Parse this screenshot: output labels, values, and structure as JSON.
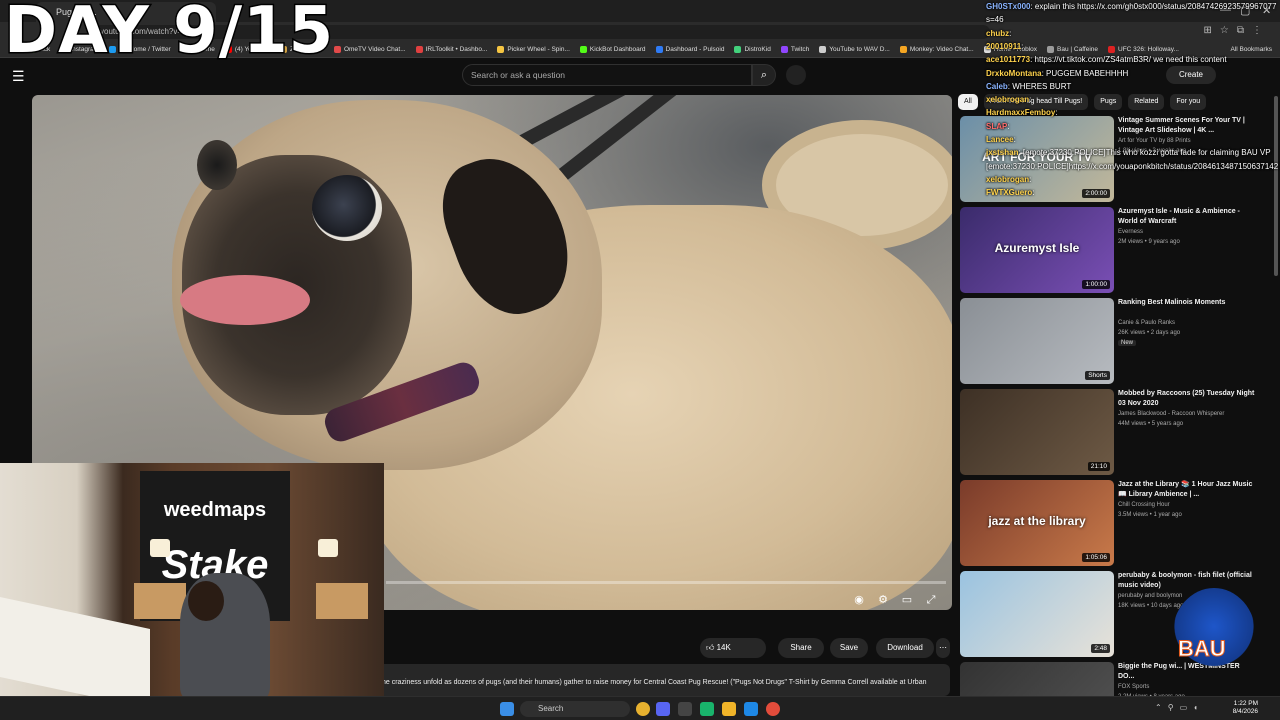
{
  "stream": {
    "day_counter": "DAY 9/15"
  },
  "browser": {
    "tab_title": "Pugs - Y...",
    "url": "youtube.com/watch?v=FGXdB",
    "bookmarks": [
      {
        "label": "Kick",
        "color": "#53fc18"
      },
      {
        "label": "Instagram",
        "color": "#e1306c"
      },
      {
        "label": "(4) Home / Twitter",
        "color": "#1d9bf0"
      },
      {
        "label": "Caffeine",
        "color": "#9b9b9b"
      },
      {
        "label": "(4) YouTube",
        "color": "#ff0000"
      },
      {
        "label": "ZIMONKEY",
        "color": "#d0a040"
      },
      {
        "label": "OmeTV Video Chat...",
        "color": "#e24a4a"
      },
      {
        "label": "IRLToolkit • Dashbo...",
        "color": "#e04040"
      },
      {
        "label": "Picker Wheel - Spin...",
        "color": "#f5c542"
      },
      {
        "label": "KickBot Dashboard",
        "color": "#53fc18"
      },
      {
        "label": "Dashboard - Pulsoid",
        "color": "#2f7bf5"
      },
      {
        "label": "DistroKid",
        "color": "#43d17c"
      },
      {
        "label": "Twitch",
        "color": "#9146ff"
      },
      {
        "label": "YouTube to WAV D...",
        "color": "#cccccc"
      },
      {
        "label": "Monkey: Video Chat...",
        "color": "#f5a623"
      },
      {
        "label": "Home - Roblox",
        "color": "#dddddd"
      },
      {
        "label": "Bau | Caffeine",
        "color": "#9b9b9b"
      },
      {
        "label": "UFC 326: Holloway...",
        "color": "#d22"
      }
    ],
    "all_bookmarks": "All Bookmarks"
  },
  "youtube": {
    "search_placeholder": "Search or ask a question",
    "create_label": "Create",
    "actions": {
      "like_count": "14K",
      "share": "Share",
      "save": "Save",
      "download": "Download"
    },
    "description": "he craziness unfold as dozens of pugs (and their humans) gather to raise money for Central Coast Pug Rescue! (\"Pugs Not Drugs\" T-Shirt by Gemma Correll available at Urban",
    "chips": [
      "All",
      "From The Pug head Till Pugs!",
      "Pugs",
      "Related",
      "For you"
    ],
    "recommendations": [
      {
        "title": "Vintage Summer Scenes For Your TV | Vintage Art Slideshow | 4K ...",
        "channel": "Art for Your TV by 88 Prints",
        "meta": "1.8K views • 3 weeks ago",
        "duration": "2:00:00",
        "thumb_text": "ART FOR YOUR TV",
        "colors": [
          "#6b8fa8",
          "#c2b89a"
        ]
      },
      {
        "title": "Azuremyst Isle - Music & Ambience - World of Warcraft",
        "channel": "Everness",
        "meta": "2M views • 9 years ago",
        "duration": "1:00:00",
        "thumb_text": "Azuremyst Isle",
        "colors": [
          "#3a2b6b",
          "#7a4fb5"
        ]
      },
      {
        "title": "Ranking Best Malinois Moments",
        "channel": "Canie & Paulo Ranks",
        "meta": "26K views • 2 days ago",
        "badge": "New",
        "duration": "Shorts",
        "thumb_text": "",
        "colors": [
          "#8a8f95",
          "#b7bbc0"
        ]
      },
      {
        "title": "Mobbed by Raccoons  (25) Tuesday Night 03 Nov 2020",
        "channel": "James Blackwood - Raccoon Whisperer",
        "meta": "44M views • 5 years ago",
        "duration": "21:10",
        "thumb_text": "",
        "colors": [
          "#3d3025",
          "#6e5a45"
        ]
      },
      {
        "title": "Jazz at the Library 📚 1 Hour Jazz Music 📖 Library Ambience | ...",
        "channel": "Chill Crossing Hour",
        "meta": "3.5M views • 1 year ago",
        "duration": "1:05:06",
        "thumb_text": "jazz at the library",
        "colors": [
          "#7a3b2a",
          "#c97a4a"
        ]
      },
      {
        "title": "perubaby & boolymon - fish filet (official music video)",
        "channel": "perubaby and boolymon",
        "meta": "18K views • 10 days ago",
        "duration": "2:48",
        "thumb_text": "",
        "colors": [
          "#9ac3e0",
          "#e8e2d8"
        ]
      },
      {
        "title": "Biggie the Pug wi... | WESTMINSTER DO...",
        "channel": "FOX Sports",
        "meta": "2.2M views • 8 years ago",
        "duration": "",
        "thumb_text": "",
        "colors": [
          "#333",
          "#555"
        ]
      }
    ]
  },
  "chat": [
    {
      "user": "GH0STx000",
      "text": "explain this https://x.com/gh0stx000/status/20847426923579967077",
      "color": "#8ab4ff"
    },
    {
      "user": "",
      "text": "s=46",
      "color": "#ffffff"
    },
    {
      "user": "chubz",
      "text": "",
      "color": "#ffd34d"
    },
    {
      "user": "20010911",
      "text": "",
      "color": "#ffd34d"
    },
    {
      "user": "ace1011773",
      "text": "https://vt.tiktok.com/ZS4atmB3R/ we need this content",
      "color": "#ffd34d"
    },
    {
      "user": "DrxkoMontana",
      "text": "PUGGEM BABEHHHH",
      "color": "#ffd34d"
    },
    {
      "user": "Caleb",
      "text": "WHERES BURT",
      "color": "#8ab4ff"
    },
    {
      "user": "xelobrogan",
      "text": "",
      "color": "#ffd34d"
    },
    {
      "user": "HardmaxxFemboy",
      "text": "",
      "color": "#ffd34d"
    },
    {
      "user": "SLAP",
      "text": "",
      "color": "#ff6b6b"
    },
    {
      "user": "Lancee",
      "text": "",
      "color": "#ffd34d"
    },
    {
      "user": "jxstshan",
      "text": "[emote:37230:POLICE]This who kozzi gotta fade for claiming BAU VP",
      "color": "#ffd34d"
    },
    {
      "user": "",
      "text": "[emote:37230:POLICE]https://x.com/youaponkbitch/status/2084613487150637142",
      "color": "#ffffff"
    },
    {
      "user": "xelobrogan",
      "text": "",
      "color": "#ffd34d"
    },
    {
      "user": "FWTXGuero",
      "text": "",
      "color": "#ffd34d"
    }
  ],
  "webcam": {
    "banner_top": "weedmaps",
    "banner_main": "Stake"
  },
  "mascot": {
    "text": "BAU"
  },
  "taskbar": {
    "search": "Search",
    "time": "1:22 PM",
    "date": "8/4/2026"
  }
}
